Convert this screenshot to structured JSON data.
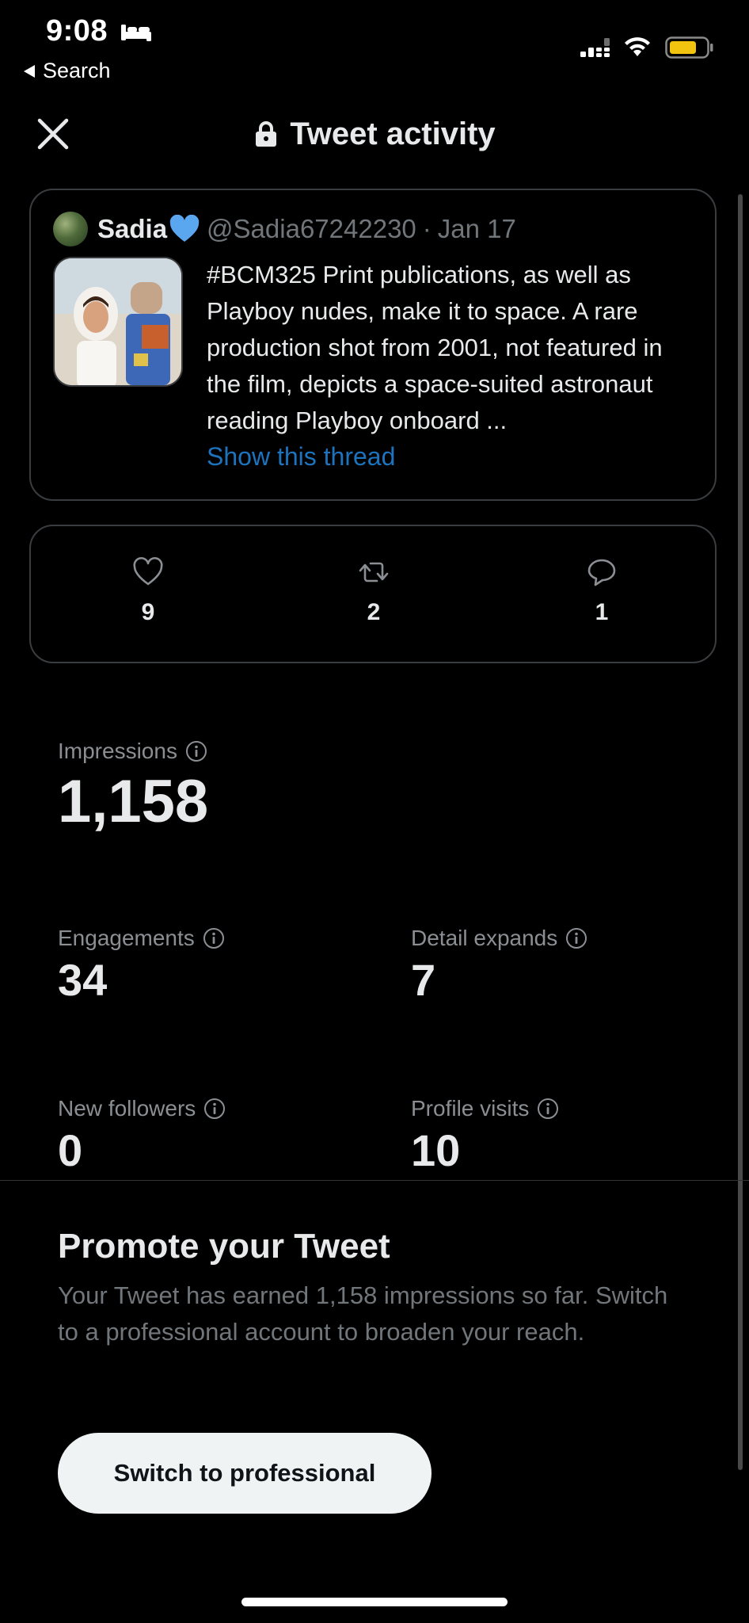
{
  "status_bar": {
    "time": "9:08",
    "back_label": "Search",
    "icons": [
      "bed-icon",
      "signal-icon",
      "wifi-icon",
      "battery-icon"
    ],
    "battery_color": "#f2c40f"
  },
  "header": {
    "title": "Tweet activity",
    "close_icon": "close-icon",
    "lock_icon": "lock-icon"
  },
  "tweet": {
    "author_name": "Sadia",
    "author_handle": "@Sadia67242230",
    "separator": "·",
    "date": "Jan 17",
    "text": "#BCM325 Print publications, as well as Playboy nudes, make it to space. A rare production shot from 2001, not featured in the film, depicts a space-suited astronaut reading Playboy onboard ...",
    "show_thread": "Show this thread"
  },
  "engagement_counts": {
    "likes": "9",
    "retweets": "2",
    "replies": "1"
  },
  "metrics": {
    "impressions": {
      "label": "Impressions",
      "value": "1,158"
    },
    "engagements": {
      "label": "Engagements",
      "value": "34"
    },
    "detail_expands": {
      "label": "Detail expands",
      "value": "7"
    },
    "new_followers": {
      "label": "New followers",
      "value": "0"
    },
    "profile_visits": {
      "label": "Profile visits",
      "value": "10"
    }
  },
  "promote": {
    "title": "Promote your Tweet",
    "body": "Your Tweet has earned 1,158 impressions so far. Switch to a professional account to broaden your reach.",
    "button_label": "Switch to professional"
  },
  "colors": {
    "background": "#000000",
    "link": "#1d73bd",
    "heart_badge": "#5aa7f0",
    "secondary_text": "#71767b",
    "button_bg": "#eff3f4"
  }
}
